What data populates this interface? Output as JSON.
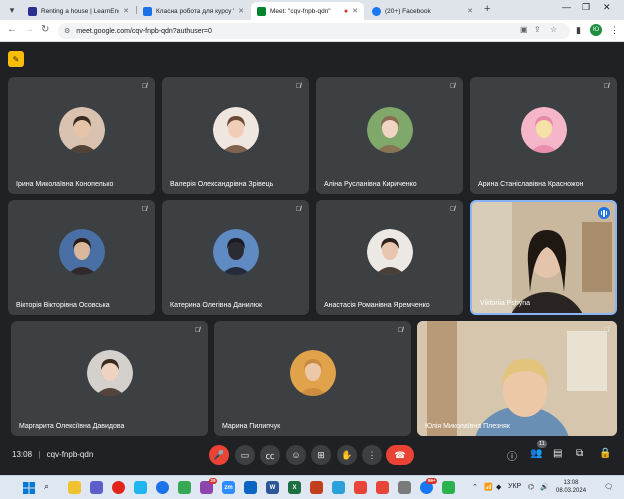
{
  "browser": {
    "tabs": [
      {
        "label": "Renting a house | LearnEnglish",
        "favicon_color": "#2b2f8f",
        "active": false
      },
      {
        "label": "Класна робота для курсу \"Пр",
        "favicon_color": "#1a73e8",
        "active": false
      },
      {
        "label": "Meet: \"cqv-fnpb-qdn\"",
        "favicon_color": "#00832d",
        "active": true
      },
      {
        "label": "(20+) Facebook",
        "favicon_color": "#1877f2",
        "active": false
      }
    ],
    "url": "meet.google.com/cqv-fnpb-qdn?authuser=0",
    "profile_initials": "Ю"
  },
  "meet": {
    "participants": [
      {
        "name": "Ірина Миколаївна Конопелько",
        "avatar_bg": "#d9c3b0",
        "skin": "#e6c4a8",
        "hair": "#3a2a20",
        "muted": true
      },
      {
        "name": "Валерія Олександрівна Зрівець",
        "avatar_bg": "#efe6e0",
        "skin": "#f0cdb6",
        "hair": "#6b4a35",
        "muted": true
      },
      {
        "name": "Аліна Русланівна Кириченко",
        "avatar_bg": "#7fa86a",
        "skin": "#f1d4c2",
        "hair": "#8a6a50",
        "muted": true
      },
      {
        "name": "Арина Станіславівна Красножон",
        "avatar_bg": "#f4b6c8",
        "skin": "#f5e0a8",
        "hair": "#e88aa8",
        "muted": true
      },
      {
        "name": "Вікторія Вікторівна Осовська",
        "avatar_bg": "#4a6fa5",
        "skin": "#d8b79c",
        "hair": "#2b1d15",
        "muted": true
      },
      {
        "name": "Катерина Олегівна Данилюк",
        "avatar_bg": "#5f8bc2",
        "skin": "#2b2b33",
        "hair": "#1a1a22",
        "muted": true
      },
      {
        "name": "Анастасія Романівна Яремченко",
        "avatar_bg": "#ece9e5",
        "skin": "#e8c5ae",
        "hair": "#2e211a",
        "muted": true
      },
      {
        "name": "Viktoriia Pshyna",
        "avatar_bg": "#c9b79e",
        "skin": "#e4c4aa",
        "hair": "#1f1812",
        "muted": false
      },
      {
        "name": "Маргарита Олексіївна Давидова",
        "avatar_bg": "#d4d0cb",
        "skin": "#efd3c0",
        "hair": "#3d2a1e",
        "muted": true
      },
      {
        "name": "Марина Пилипчук",
        "avatar_bg": "#e0a24a",
        "skin": "#ecc7a8",
        "hair": "#c88a3e",
        "muted": true
      },
      {
        "name": "Юлія Миколаївна Плезняк",
        "avatar_bg": "#d6c6ae",
        "skin": "#ecc8a6",
        "hair": "#e2c47c",
        "muted": true
      }
    ],
    "time": "13:08",
    "meeting_code": "cqv-fnpb-qdn",
    "participants_count": "11"
  },
  "taskbar": {
    "apps": [
      {
        "label": "",
        "color": "#f2c12e",
        "badge": ""
      },
      {
        "label": "",
        "color": "#5b5fc7",
        "badge": ""
      },
      {
        "label": "",
        "color": "#e1251b",
        "badge": ""
      },
      {
        "label": "",
        "color": "#1fb6ef",
        "badge": ""
      },
      {
        "label": "",
        "color": "#1a73e8",
        "badge": ""
      },
      {
        "label": "",
        "color": "#34a853",
        "badge": ""
      },
      {
        "label": "",
        "color": "#8e44ad",
        "badge": "29"
      },
      {
        "label": "zm",
        "color": "#2d8cff",
        "badge": ""
      },
      {
        "label": "",
        "color": "#0a66c2",
        "badge": ""
      },
      {
        "label": "W",
        "color": "#2b579a",
        "badge": ""
      },
      {
        "label": "X",
        "color": "#1d6f42",
        "badge": ""
      },
      {
        "label": "",
        "color": "#c43e1c",
        "badge": ""
      },
      {
        "label": "",
        "color": "#2aa1d8",
        "badge": ""
      },
      {
        "label": "",
        "color": "#e8443a",
        "badge": ""
      },
      {
        "label": "",
        "color": "#e8443a",
        "badge": ""
      },
      {
        "label": "",
        "color": "#7a7a7a",
        "badge": ""
      },
      {
        "label": "",
        "color": "#1877f2",
        "badge": "99+"
      },
      {
        "label": "",
        "color": "#2bb24c",
        "badge": ""
      }
    ],
    "lang": "УКР",
    "time": "13:08",
    "date": "08.03.2024"
  },
  "colors": {
    "accent": "#1a73e8",
    "danger": "#ea4335",
    "tile": "#3c4043",
    "bg": "#202124"
  }
}
